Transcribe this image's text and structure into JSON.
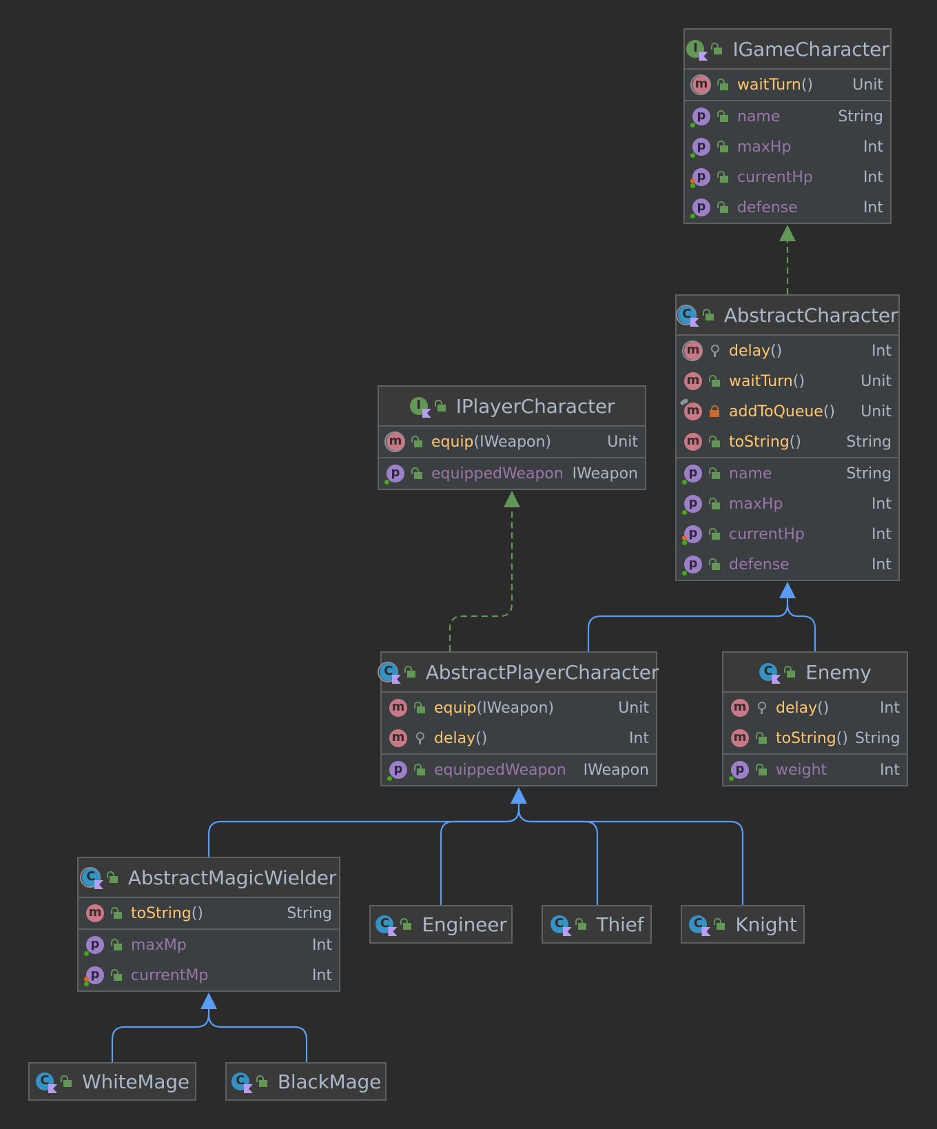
{
  "colors": {
    "background": "#2b2b2b",
    "node_fill": "#3c3f41",
    "node_border": "#5e6062",
    "method_name": "#ffc66d",
    "property_name": "#9876aa",
    "type_text": "#a9b7c6",
    "inheritance_edge": "#589df6",
    "realization_edge": "#629755"
  },
  "nodes": [
    {
      "id": "IGameCharacter",
      "name": "IGameCharacter",
      "kind": "interface",
      "icon": "kotlin-interface-icon",
      "visibility": "public",
      "methods": [
        {
          "name": "waitTurn",
          "params": "",
          "type": "Unit",
          "visibility": "public",
          "abstract": true
        }
      ],
      "properties": [
        {
          "name": "name",
          "type": "String",
          "visibility": "public",
          "mutable": false
        },
        {
          "name": "maxHp",
          "type": "Int",
          "visibility": "public",
          "mutable": false
        },
        {
          "name": "currentHp",
          "type": "Int",
          "visibility": "public",
          "mutable": true
        },
        {
          "name": "defense",
          "type": "Int",
          "visibility": "public",
          "mutable": false
        }
      ]
    },
    {
      "id": "AbstractCharacter",
      "name": "AbstractCharacter",
      "kind": "abstract-class",
      "icon": "kotlin-abstract-class-icon",
      "visibility": "public",
      "methods": [
        {
          "name": "delay",
          "params": "",
          "type": "Int",
          "visibility": "protected",
          "abstract": true
        },
        {
          "name": "waitTurn",
          "params": "",
          "type": "Unit",
          "visibility": "public",
          "abstract": false
        },
        {
          "name": "addToQueue",
          "params": "",
          "type": "Unit",
          "visibility": "private",
          "abstract": false,
          "pinned": true
        },
        {
          "name": "toString",
          "params": "",
          "type": "String",
          "visibility": "public",
          "abstract": false
        }
      ],
      "properties": [
        {
          "name": "name",
          "type": "String",
          "visibility": "public",
          "mutable": false
        },
        {
          "name": "maxHp",
          "type": "Int",
          "visibility": "public",
          "mutable": false
        },
        {
          "name": "currentHp",
          "type": "Int",
          "visibility": "public",
          "mutable": true
        },
        {
          "name": "defense",
          "type": "Int",
          "visibility": "public",
          "mutable": false
        }
      ]
    },
    {
      "id": "IPlayerCharacter",
      "name": "IPlayerCharacter",
      "kind": "interface",
      "icon": "kotlin-interface-icon",
      "visibility": "public",
      "methods": [
        {
          "name": "equip",
          "params": "IWeapon",
          "type": "Unit",
          "visibility": "public",
          "abstract": true
        }
      ],
      "properties": [
        {
          "name": "equippedWeapon",
          "type": "IWeapon",
          "visibility": "public",
          "mutable": false
        }
      ]
    },
    {
      "id": "AbstractPlayerCharacter",
      "name": "AbstractPlayerCharacter",
      "kind": "abstract-class",
      "icon": "kotlin-abstract-class-icon",
      "visibility": "public",
      "methods": [
        {
          "name": "equip",
          "params": "IWeapon",
          "type": "Unit",
          "visibility": "public",
          "abstract": false
        },
        {
          "name": "delay",
          "params": "",
          "type": "Int",
          "visibility": "protected",
          "abstract": false
        }
      ],
      "properties": [
        {
          "name": "equippedWeapon",
          "type": "IWeapon",
          "visibility": "public",
          "mutable": false
        }
      ]
    },
    {
      "id": "Enemy",
      "name": "Enemy",
      "kind": "class",
      "icon": "kotlin-class-icon",
      "visibility": "public",
      "methods": [
        {
          "name": "delay",
          "params": "",
          "type": "Int",
          "visibility": "protected",
          "abstract": false
        },
        {
          "name": "toString",
          "params": "",
          "type": "String",
          "visibility": "public",
          "abstract": false
        }
      ],
      "properties": [
        {
          "name": "weight",
          "type": "Int",
          "visibility": "public",
          "mutable": false
        }
      ]
    },
    {
      "id": "AbstractMagicWielder",
      "name": "AbstractMagicWielder",
      "kind": "abstract-class",
      "icon": "kotlin-abstract-class-icon",
      "visibility": "public",
      "methods": [
        {
          "name": "toString",
          "params": "",
          "type": "String",
          "visibility": "public",
          "abstract": false
        }
      ],
      "properties": [
        {
          "name": "maxMp",
          "type": "Int",
          "visibility": "public",
          "mutable": false
        },
        {
          "name": "currentMp",
          "type": "Int",
          "visibility": "public",
          "mutable": true
        }
      ]
    },
    {
      "id": "Engineer",
      "name": "Engineer",
      "kind": "class",
      "icon": "kotlin-class-icon",
      "visibility": "public",
      "methods": [],
      "properties": []
    },
    {
      "id": "Thief",
      "name": "Thief",
      "kind": "class",
      "icon": "kotlin-class-icon",
      "visibility": "public",
      "methods": [],
      "properties": []
    },
    {
      "id": "Knight",
      "name": "Knight",
      "kind": "class",
      "icon": "kotlin-class-icon",
      "visibility": "public",
      "methods": [],
      "properties": []
    },
    {
      "id": "WhiteMage",
      "name": "WhiteMage",
      "kind": "class",
      "icon": "kotlin-class-icon",
      "visibility": "public",
      "methods": [],
      "properties": []
    },
    {
      "id": "BlackMage",
      "name": "BlackMage",
      "kind": "class",
      "icon": "kotlin-class-icon",
      "visibility": "public",
      "methods": [],
      "properties": []
    }
  ],
  "edges": [
    {
      "from": "AbstractCharacter",
      "to": "IGameCharacter",
      "type": "realization"
    },
    {
      "from": "AbstractPlayerCharacter",
      "to": "IPlayerCharacter",
      "type": "realization"
    },
    {
      "from": "AbstractPlayerCharacter",
      "to": "AbstractCharacter",
      "type": "inheritance"
    },
    {
      "from": "Enemy",
      "to": "AbstractCharacter",
      "type": "inheritance"
    },
    {
      "from": "AbstractMagicWielder",
      "to": "AbstractPlayerCharacter",
      "type": "inheritance"
    },
    {
      "from": "Engineer",
      "to": "AbstractPlayerCharacter",
      "type": "inheritance"
    },
    {
      "from": "Thief",
      "to": "AbstractPlayerCharacter",
      "type": "inheritance"
    },
    {
      "from": "Knight",
      "to": "AbstractPlayerCharacter",
      "type": "inheritance"
    },
    {
      "from": "WhiteMage",
      "to": "AbstractMagicWielder",
      "type": "inheritance"
    },
    {
      "from": "BlackMage",
      "to": "AbstractMagicWielder",
      "type": "inheritance"
    }
  ]
}
